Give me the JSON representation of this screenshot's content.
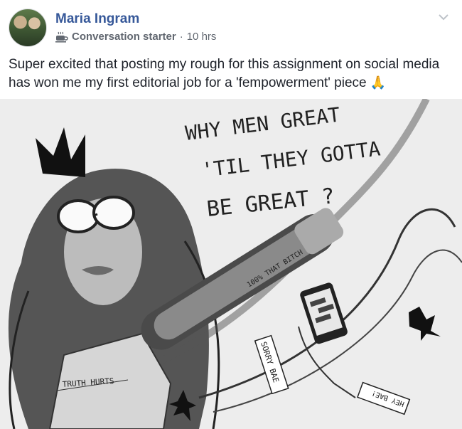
{
  "post": {
    "author": "Maria Ingram",
    "badge": "Conversation starter",
    "separator": "·",
    "time": "10 hrs",
    "text": "Super excited that posting my rough for this assignment on social media has won me my first editorial job for a 'fempowerment' piece",
    "emoji": "🙏"
  },
  "illustration": {
    "headline_line1": "WHY MEN GREAT",
    "headline_line2": "'TIL THEY GOTTA",
    "headline_line3": "BE GREAT ?",
    "iron_label": "100% THAT BITCH",
    "shirt_label": "TRUTH HURTS",
    "tag1": "SORRY BAE",
    "tag2": "HEY BAE!"
  },
  "colors": {
    "link": "#365899",
    "meta": "#616770",
    "text": "#1d2129"
  },
  "icons": {
    "badge": "coffee-cup-icon",
    "menu": "chevron-down-icon"
  }
}
